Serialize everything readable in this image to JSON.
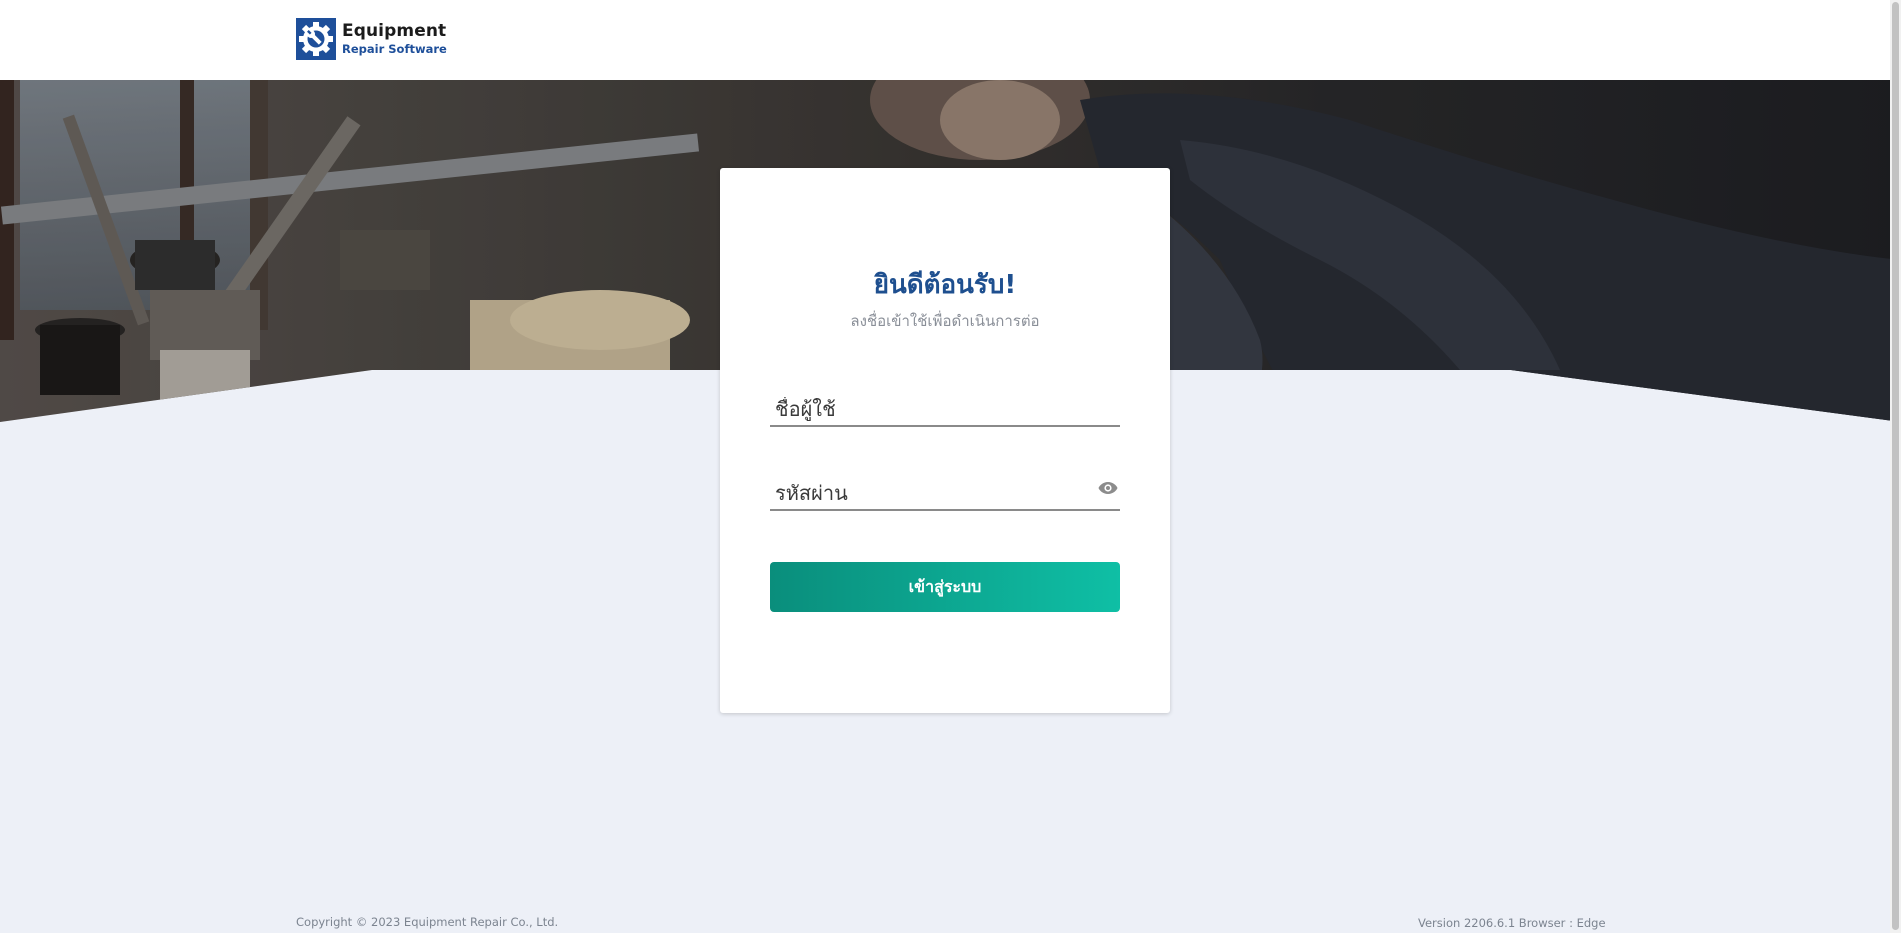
{
  "header": {
    "logo_title": "Equipment",
    "logo_subtitle": "Repair Software"
  },
  "login": {
    "title": "ยินดีต้อนรับ!",
    "subtitle": "ลงชื่อเข้าใช้เพื่อดำเนินการต่อ",
    "username_placeholder": "ชื่อผู้ใช้",
    "username_value": "",
    "password_placeholder": "รหัสผ่าน",
    "password_value": "",
    "submit_label": "เข้าสู่ระบบ"
  },
  "footer": {
    "copyright": "Copyright © 2023 Equipment Repair Co., Ltd.",
    "version": "Version 2206.6.1 Browser : Edge"
  },
  "colors": {
    "brand_blue": "#1e4f8f",
    "button_start": "#0a8e7c",
    "button_end": "#0fbfa5",
    "page_bg": "#edf0f7"
  },
  "icons": {
    "logo": "gear-wrench-icon",
    "password_toggle": "eye-icon"
  }
}
